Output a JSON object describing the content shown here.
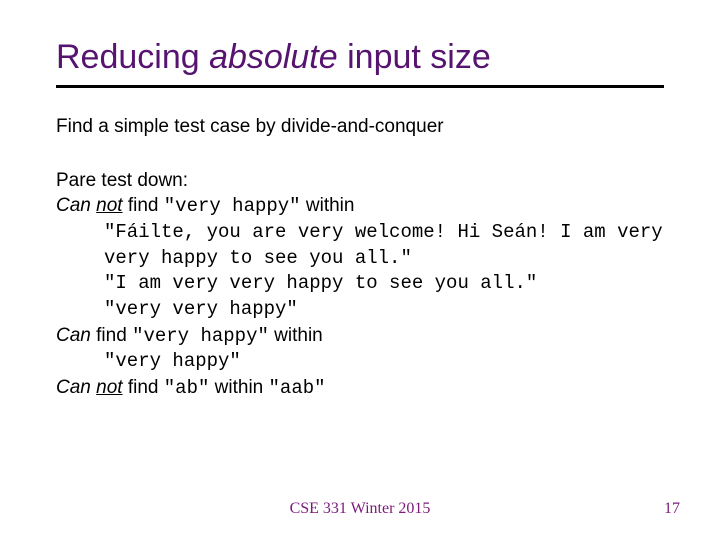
{
  "title_part1": "Reducing ",
  "title_abs": "absolute",
  "title_part2": " input size",
  "intro": "Find a simple test case by divide-and-conquer",
  "pare": "Pare test down:",
  "l1a": "Can ",
  "l1b": "not",
  "l1c": " find ",
  "l1d": "\"very happy\"",
  "l1e": " within",
  "q1": "\"Fáilte, you are very welcome! Hi Seán! I am very very happy to see you all.\"",
  "q2": "\"I am very very happy to see you all.\"",
  "q3": "\"very very happy\"",
  "l2a": "Can",
  "l2b": " find ",
  "l2c": "\"very happy\"",
  "l2d": " within",
  "q4": "\"very happy\"",
  "l3a": "Can ",
  "l3b": "not",
  "l3c": " find ",
  "l3d": "\"ab\"",
  "l3e": " within ",
  "l3f": "\"aab\"",
  "footer_center": "CSE 331 Winter 2015",
  "footer_right": "17"
}
